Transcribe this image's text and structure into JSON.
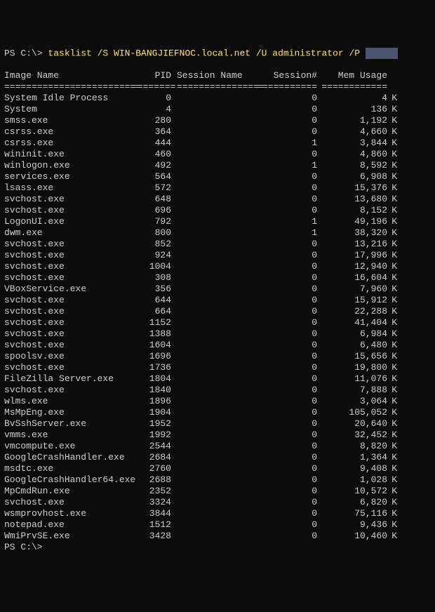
{
  "prompt": {
    "ps": "PS C:\\>",
    "cmd": "tasklist /S WIN-BANGJIEFNOC.local.net /U administrator /P"
  },
  "headers": {
    "name": "Image Name",
    "pid": "PID",
    "session": "Session Name",
    "snum": "Session#",
    "mem": "Mem Usage"
  },
  "sep": {
    "name": "=========================",
    "pid": "========",
    "session": "================",
    "snum": "===========",
    "mem": "============"
  },
  "rows": [
    {
      "name": "System Idle Process",
      "pid": 0,
      "session": "",
      "snum": 0,
      "mem": "4"
    },
    {
      "name": "System",
      "pid": 4,
      "session": "",
      "snum": 0,
      "mem": "136"
    },
    {
      "name": "smss.exe",
      "pid": 280,
      "session": "",
      "snum": 0,
      "mem": "1,192"
    },
    {
      "name": "csrss.exe",
      "pid": 364,
      "session": "",
      "snum": 0,
      "mem": "4,660"
    },
    {
      "name": "csrss.exe",
      "pid": 444,
      "session": "",
      "snum": 1,
      "mem": "3,844"
    },
    {
      "name": "wininit.exe",
      "pid": 460,
      "session": "",
      "snum": 0,
      "mem": "4,860"
    },
    {
      "name": "winlogon.exe",
      "pid": 492,
      "session": "",
      "snum": 1,
      "mem": "8,592"
    },
    {
      "name": "services.exe",
      "pid": 564,
      "session": "",
      "snum": 0,
      "mem": "6,908"
    },
    {
      "name": "lsass.exe",
      "pid": 572,
      "session": "",
      "snum": 0,
      "mem": "15,376"
    },
    {
      "name": "svchost.exe",
      "pid": 648,
      "session": "",
      "snum": 0,
      "mem": "13,680"
    },
    {
      "name": "svchost.exe",
      "pid": 696,
      "session": "",
      "snum": 0,
      "mem": "8,152"
    },
    {
      "name": "LogonUI.exe",
      "pid": 792,
      "session": "",
      "snum": 1,
      "mem": "49,196"
    },
    {
      "name": "dwm.exe",
      "pid": 800,
      "session": "",
      "snum": 1,
      "mem": "38,320"
    },
    {
      "name": "svchost.exe",
      "pid": 852,
      "session": "",
      "snum": 0,
      "mem": "13,216"
    },
    {
      "name": "svchost.exe",
      "pid": 924,
      "session": "",
      "snum": 0,
      "mem": "17,996"
    },
    {
      "name": "svchost.exe",
      "pid": 1004,
      "session": "",
      "snum": 0,
      "mem": "12,940"
    },
    {
      "name": "svchost.exe",
      "pid": 308,
      "session": "",
      "snum": 0,
      "mem": "16,604"
    },
    {
      "name": "VBoxService.exe",
      "pid": 356,
      "session": "",
      "snum": 0,
      "mem": "7,960"
    },
    {
      "name": "svchost.exe",
      "pid": 644,
      "session": "",
      "snum": 0,
      "mem": "15,912"
    },
    {
      "name": "svchost.exe",
      "pid": 664,
      "session": "",
      "snum": 0,
      "mem": "22,288"
    },
    {
      "name": "svchost.exe",
      "pid": 1152,
      "session": "",
      "snum": 0,
      "mem": "41,404"
    },
    {
      "name": "svchost.exe",
      "pid": 1388,
      "session": "",
      "snum": 0,
      "mem": "6,984"
    },
    {
      "name": "svchost.exe",
      "pid": 1604,
      "session": "",
      "snum": 0,
      "mem": "6,480"
    },
    {
      "name": "spoolsv.exe",
      "pid": 1696,
      "session": "",
      "snum": 0,
      "mem": "15,656"
    },
    {
      "name": "svchost.exe",
      "pid": 1736,
      "session": "",
      "snum": 0,
      "mem": "19,800"
    },
    {
      "name": "FileZilla Server.exe",
      "pid": 1804,
      "session": "",
      "snum": 0,
      "mem": "11,076"
    },
    {
      "name": "svchost.exe",
      "pid": 1840,
      "session": "",
      "snum": 0,
      "mem": "7,888"
    },
    {
      "name": "wlms.exe",
      "pid": 1896,
      "session": "",
      "snum": 0,
      "mem": "3,064"
    },
    {
      "name": "MsMpEng.exe",
      "pid": 1904,
      "session": "",
      "snum": 0,
      "mem": "105,052"
    },
    {
      "name": "BvSshServer.exe",
      "pid": 1952,
      "session": "",
      "snum": 0,
      "mem": "20,640"
    },
    {
      "name": "vmms.exe",
      "pid": 1992,
      "session": "",
      "snum": 0,
      "mem": "32,452"
    },
    {
      "name": "vmcompute.exe",
      "pid": 2544,
      "session": "",
      "snum": 0,
      "mem": "8,820"
    },
    {
      "name": "GoogleCrashHandler.exe",
      "pid": 2684,
      "session": "",
      "snum": 0,
      "mem": "1,364"
    },
    {
      "name": "msdtc.exe",
      "pid": 2760,
      "session": "",
      "snum": 0,
      "mem": "9,408"
    },
    {
      "name": "GoogleCrashHandler64.exe",
      "pid": 2688,
      "session": "",
      "snum": 0,
      "mem": "1,028"
    },
    {
      "name": "MpCmdRun.exe",
      "pid": 2352,
      "session": "",
      "snum": 0,
      "mem": "10,572"
    },
    {
      "name": "svchost.exe",
      "pid": 3324,
      "session": "",
      "snum": 0,
      "mem": "6,820"
    },
    {
      "name": "wsmprovhost.exe",
      "pid": 3844,
      "session": "",
      "snum": 0,
      "mem": "75,116"
    },
    {
      "name": "notepad.exe",
      "pid": 1512,
      "session": "",
      "snum": 0,
      "mem": "9,436"
    },
    {
      "name": "WmiPrvSE.exe",
      "pid": 3428,
      "session": "",
      "snum": 0,
      "mem": "10,460"
    }
  ],
  "post_prompt": "PS C:\\>",
  "mem_unit": "K"
}
